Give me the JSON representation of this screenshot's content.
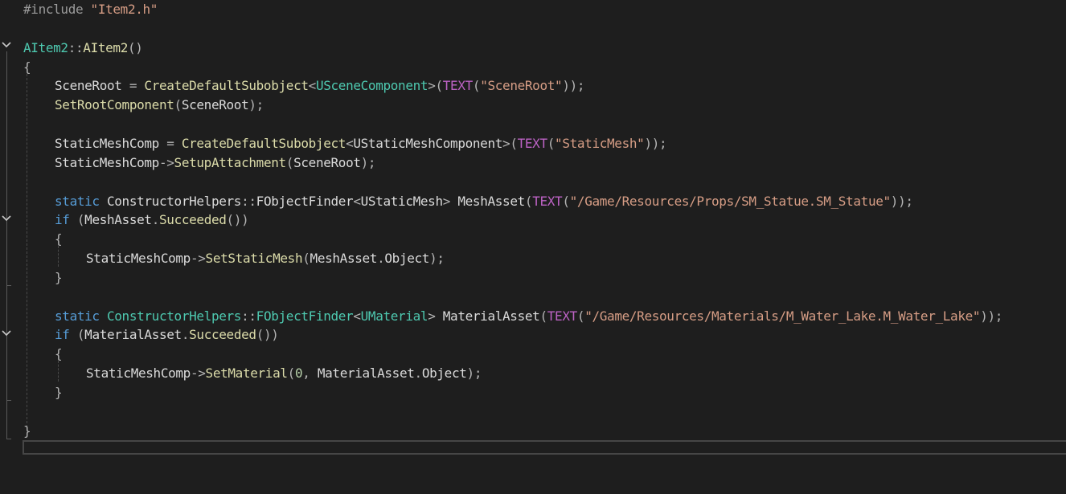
{
  "editor": {
    "colors": {
      "background": "#1e1e1e",
      "preprocessor": "#9b9b9b",
      "string": "#d69d85",
      "type": "#4ec9b0",
      "function": "#dcdcaa",
      "keyword": "#569cd6",
      "macro": "#bd63c5",
      "identifier": "#dadada"
    },
    "fold_icons": [
      "chevron-down-icon",
      "chevron-down-icon",
      "chevron-down-icon"
    ],
    "lines": [
      {
        "indent": 0,
        "tokens": [
          [
            "pp",
            "#include "
          ],
          [
            "str",
            "\"Item2.h\""
          ]
        ]
      },
      {
        "indent": 0,
        "tokens": []
      },
      {
        "indent": 0,
        "tokens": [
          [
            "type",
            "AItem2"
          ],
          [
            "punc",
            "::"
          ],
          [
            "fn",
            "AItem2"
          ],
          [
            "punc",
            "()"
          ]
        ]
      },
      {
        "indent": 0,
        "tokens": [
          [
            "punc",
            "{"
          ]
        ]
      },
      {
        "indent": 1,
        "tokens": [
          [
            "var",
            "SceneRoot"
          ],
          [
            "punc",
            " = "
          ],
          [
            "fn",
            "CreateDefaultSubobject"
          ],
          [
            "punc",
            "<"
          ],
          [
            "type",
            "USceneComponent"
          ],
          [
            "punc",
            ">("
          ],
          [
            "macro",
            "TEXT"
          ],
          [
            "punc",
            "("
          ],
          [
            "str",
            "\"SceneRoot\""
          ],
          [
            "punc",
            "));"
          ]
        ]
      },
      {
        "indent": 1,
        "tokens": [
          [
            "fn",
            "SetRootComponent"
          ],
          [
            "punc",
            "("
          ],
          [
            "var",
            "SceneRoot"
          ],
          [
            "punc",
            ");"
          ]
        ]
      },
      {
        "indent": 1,
        "tokens": []
      },
      {
        "indent": 1,
        "tokens": [
          [
            "var",
            "StaticMeshComp"
          ],
          [
            "punc",
            " = "
          ],
          [
            "fn",
            "CreateDefaultSubobject"
          ],
          [
            "punc",
            "<"
          ],
          [
            "var",
            "UStaticMeshComponent"
          ],
          [
            "punc",
            ">("
          ],
          [
            "macro",
            "TEXT"
          ],
          [
            "punc",
            "("
          ],
          [
            "str",
            "\"StaticMesh\""
          ],
          [
            "punc",
            "));"
          ]
        ]
      },
      {
        "indent": 1,
        "tokens": [
          [
            "var",
            "StaticMeshComp"
          ],
          [
            "punc",
            "->"
          ],
          [
            "fn",
            "SetupAttachment"
          ],
          [
            "punc",
            "("
          ],
          [
            "var",
            "SceneRoot"
          ],
          [
            "punc",
            ");"
          ]
        ]
      },
      {
        "indent": 1,
        "tokens": []
      },
      {
        "indent": 1,
        "tokens": [
          [
            "kw",
            "static "
          ],
          [
            "var",
            "ConstructorHelpers"
          ],
          [
            "punc",
            "::"
          ],
          [
            "var",
            "FObjectFinder"
          ],
          [
            "punc",
            "<"
          ],
          [
            "var",
            "UStaticMesh"
          ],
          [
            "punc",
            "> "
          ],
          [
            "var",
            "MeshAsset"
          ],
          [
            "punc",
            "("
          ],
          [
            "macro",
            "TEXT"
          ],
          [
            "punc",
            "("
          ],
          [
            "str",
            "\"/Game/Resources/Props/SM_Statue.SM_Statue\""
          ],
          [
            "punc",
            "));"
          ]
        ]
      },
      {
        "indent": 1,
        "tokens": [
          [
            "kw",
            "if "
          ],
          [
            "punc",
            "("
          ],
          [
            "var",
            "MeshAsset"
          ],
          [
            "punc",
            "."
          ],
          [
            "fn",
            "Succeeded"
          ],
          [
            "punc",
            "())"
          ]
        ]
      },
      {
        "indent": 1,
        "tokens": [
          [
            "punc",
            "{"
          ]
        ]
      },
      {
        "indent": 2,
        "tokens": [
          [
            "var",
            "StaticMeshComp"
          ],
          [
            "punc",
            "->"
          ],
          [
            "fn",
            "SetStaticMesh"
          ],
          [
            "punc",
            "("
          ],
          [
            "var",
            "MeshAsset"
          ],
          [
            "punc",
            "."
          ],
          [
            "var",
            "Object"
          ],
          [
            "punc",
            ");"
          ]
        ]
      },
      {
        "indent": 1,
        "tokens": [
          [
            "punc",
            "}"
          ]
        ]
      },
      {
        "indent": 1,
        "tokens": []
      },
      {
        "indent": 1,
        "tokens": [
          [
            "kw",
            "static "
          ],
          [
            "type",
            "ConstructorHelpers"
          ],
          [
            "punc",
            "::"
          ],
          [
            "type",
            "FObjectFinder"
          ],
          [
            "punc",
            "<"
          ],
          [
            "type",
            "UMaterial"
          ],
          [
            "punc",
            "> "
          ],
          [
            "var",
            "MaterialAsset"
          ],
          [
            "punc",
            "("
          ],
          [
            "macro",
            "TEXT"
          ],
          [
            "punc",
            "("
          ],
          [
            "str",
            "\"/Game/Resources/Materials/M_Water_Lake.M_Water_Lake\""
          ],
          [
            "punc",
            "));"
          ]
        ]
      },
      {
        "indent": 1,
        "tokens": [
          [
            "kw",
            "if "
          ],
          [
            "punc",
            "("
          ],
          [
            "var",
            "MaterialAsset"
          ],
          [
            "punc",
            "."
          ],
          [
            "fn",
            "Succeeded"
          ],
          [
            "punc",
            "())"
          ]
        ]
      },
      {
        "indent": 1,
        "tokens": [
          [
            "punc",
            "{"
          ]
        ]
      },
      {
        "indent": 2,
        "tokens": [
          [
            "var",
            "StaticMeshComp"
          ],
          [
            "punc",
            "->"
          ],
          [
            "fn",
            "SetMaterial"
          ],
          [
            "punc",
            "("
          ],
          [
            "num",
            "0"
          ],
          [
            "punc",
            ", "
          ],
          [
            "var",
            "MaterialAsset"
          ],
          [
            "punc",
            "."
          ],
          [
            "var",
            "Object"
          ],
          [
            "punc",
            ");"
          ]
        ]
      },
      {
        "indent": 1,
        "tokens": [
          [
            "punc",
            "}"
          ]
        ]
      },
      {
        "indent": 1,
        "tokens": []
      },
      {
        "indent": 0,
        "tokens": [
          [
            "punc",
            "}"
          ]
        ]
      }
    ]
  }
}
